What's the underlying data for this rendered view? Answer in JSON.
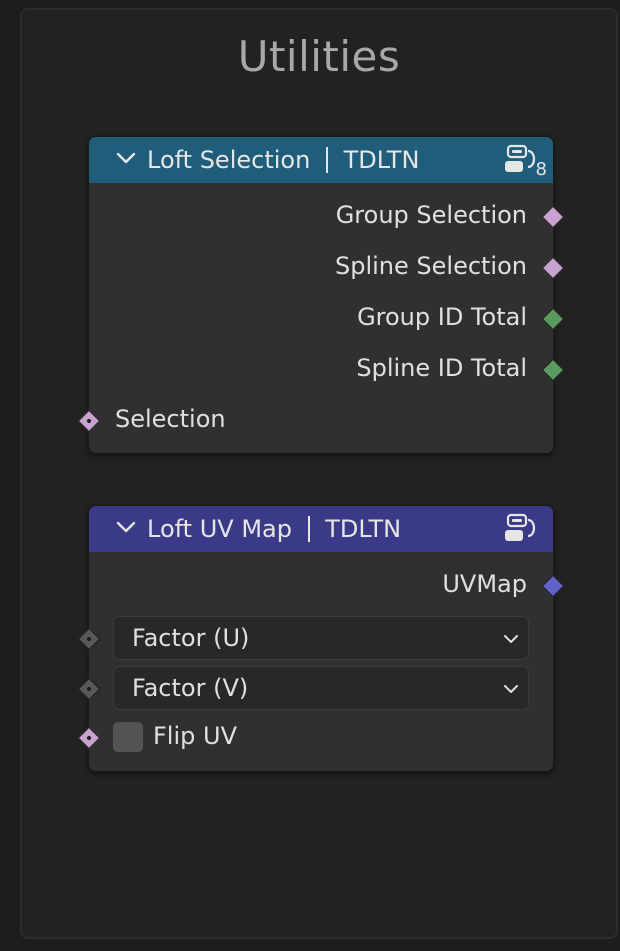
{
  "frame": {
    "title": "Utilities"
  },
  "nodes": [
    {
      "title": "Loft Selection",
      "subtitle": "TDLTN",
      "header_color": "#1f5d7a",
      "badge": "8",
      "outputs": [
        {
          "label": "Group Selection",
          "socket_color": "#c9a3cf"
        },
        {
          "label": "Spline Selection",
          "socket_color": "#c9a3cf"
        },
        {
          "label": "Group ID Total",
          "socket_color": "#5b9a5e"
        },
        {
          "label": "Spline ID Total",
          "socket_color": "#5b9a5e"
        }
      ],
      "inputs": [
        {
          "label": "Selection",
          "socket_color": "#c9a3cf"
        }
      ]
    },
    {
      "title": "Loft UV Map",
      "subtitle": "TDLTN",
      "header_color": "#3b3a88",
      "outputs": [
        {
          "label": "UVMap",
          "socket_color": "#6363c7"
        }
      ],
      "inputs": [
        {
          "label": "Factor (U)",
          "socket_color": "#595959"
        },
        {
          "label": "Factor (V)",
          "socket_color": "#595959"
        },
        {
          "label": "Flip UV",
          "socket_color": "#c9a3cf",
          "checked": false
        }
      ]
    }
  ]
}
